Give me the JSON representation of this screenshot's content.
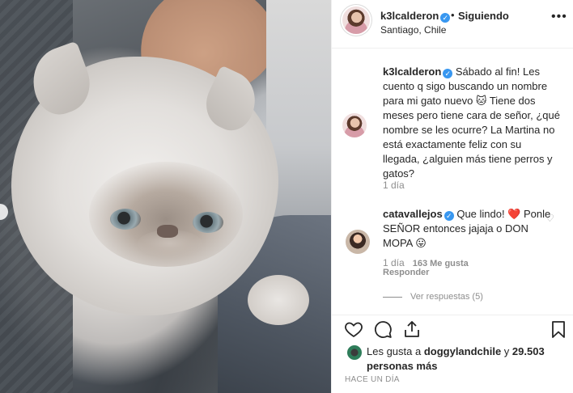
{
  "post": {
    "username": "k3lcalderon",
    "separator": "•",
    "follow_status": "Siguiendo",
    "location": "Santiago, Chile",
    "more_icon": "ellipsis-icon"
  },
  "caption": {
    "username": "k3lcalderon",
    "text": "Sábado al fin! Les cuento q sigo buscando un nombre para mi gato nuevo 🐱 Tiene dos meses pero tiene cara de señor, ¿qué nombre se les ocurre? La Martina no está exactamente feliz con su llegada, ¿alguien más tiene perros y gatos?",
    "time": "1 día"
  },
  "comment": {
    "username": "catavallejos",
    "text": "Que lindo! ❤️ Ponle SEÑOR entonces jajaja o DON MOPA 😛",
    "time": "1 día",
    "likes": "163 Me gusta",
    "reply_label": "Responder",
    "view_replies": "Ver respuestas (5)"
  },
  "actions": {
    "like_icon": "heart-icon",
    "comment_icon": "comment-icon",
    "share_icon": "share-icon",
    "save_icon": "bookmark-icon"
  },
  "likes_summary": {
    "prefix": "Les gusta a ",
    "user": "doggylandchile",
    "middle": " y ",
    "count": "29.503 personas más"
  },
  "timestamp": "HACE UN DÍA",
  "colors": {
    "verified_blue": "#3897f0",
    "text": "#262626",
    "muted": "#8e8e8e",
    "border": "#efefef"
  }
}
